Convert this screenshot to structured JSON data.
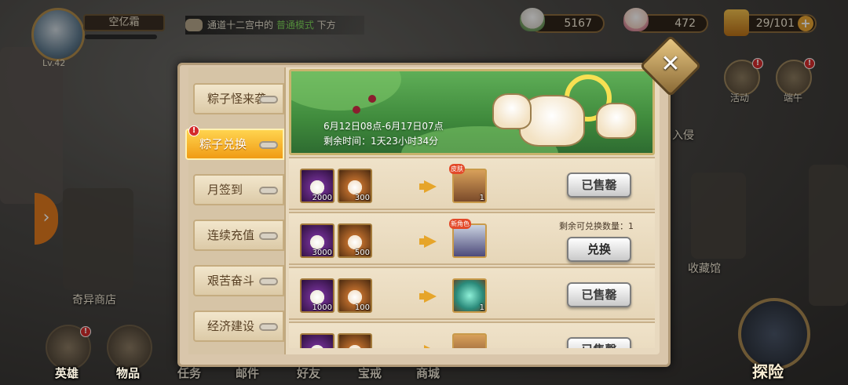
{
  "player": {
    "name": "空亿霜",
    "level": "Lv.42"
  },
  "ticker": {
    "pre": "通道十二宫中的 ",
    "highlight": "普通模式",
    "post": " 下方"
  },
  "resources": [
    {
      "name": "green-zongzi",
      "value": "5167"
    },
    {
      "name": "pink-zongzi",
      "value": "472"
    },
    {
      "name": "stamina",
      "value": "29/101"
    }
  ],
  "side_buttons": [
    {
      "label": "活动",
      "icon": "activity-icon",
      "badge": "!"
    },
    {
      "label": "端午",
      "icon": "dragon-boat-icon",
      "badge": "!"
    }
  ],
  "map_labels": [
    "奇异商店",
    "收藏馆",
    "入侵"
  ],
  "bottom_nav": [
    {
      "label": "英雄",
      "icon": "hero-helmet-icon",
      "badge": "!"
    },
    {
      "label": "物品",
      "icon": "bag-icon",
      "badge": ""
    },
    {
      "label": "任务",
      "icon": "quest-icon",
      "badge": ""
    },
    {
      "label": "邮件",
      "icon": "mail-icon",
      "badge": ""
    },
    {
      "label": "好友",
      "icon": "friends-icon",
      "badge": ""
    },
    {
      "label": "宝戒",
      "icon": "ring-icon",
      "badge": ""
    },
    {
      "label": "商城",
      "icon": "shop-icon",
      "badge": ""
    }
  ],
  "explore": {
    "label": "探险"
  },
  "panel": {
    "tabs": [
      {
        "label": "粽子怪来袭",
        "active": false
      },
      {
        "label": "粽子兑换",
        "active": true,
        "badge": "!"
      },
      {
        "label": "月签到",
        "active": false
      },
      {
        "label": "连续充值",
        "active": false
      },
      {
        "label": "艰苦奋斗",
        "active": false
      },
      {
        "label": "经济建设",
        "active": false
      }
    ],
    "banner": {
      "date": "6月12日08点-6月17日07点",
      "remain": "剩余时间：1天23小时34分"
    },
    "exchanges": [
      {
        "cost": [
          {
            "type": "purple",
            "qty": "2000"
          },
          {
            "type": "orange",
            "qty": "300"
          }
        ],
        "reward": {
          "type": "hero",
          "qty": "1",
          "tag": "皮肤"
        },
        "button": "已售罄",
        "remain": ""
      },
      {
        "cost": [
          {
            "type": "purple",
            "qty": "3000"
          },
          {
            "type": "orange",
            "qty": "500"
          }
        ],
        "reward": {
          "type": "hero2",
          "qty": "",
          "tag": "新角色"
        },
        "button": "兑换",
        "remain": "剩余可兑换数量：1"
      },
      {
        "cost": [
          {
            "type": "purple",
            "qty": "1000"
          },
          {
            "type": "orange",
            "qty": "100"
          }
        ],
        "reward": {
          "type": "orb",
          "qty": "1",
          "tag": ""
        },
        "button": "已售罄",
        "remain": ""
      },
      {
        "cost": [
          {
            "type": "purple",
            "qty": ""
          },
          {
            "type": "orange",
            "qty": ""
          }
        ],
        "reward": {
          "type": "hero",
          "qty": "",
          "tag": ""
        },
        "button": "已售罄",
        "remain": ""
      }
    ]
  },
  "colors": {
    "tab_active": "#f09b14",
    "panel_bg": "#e8d9bf",
    "banner_green": "#3f8a3c",
    "ticker_highlight": "#7fd65a"
  }
}
